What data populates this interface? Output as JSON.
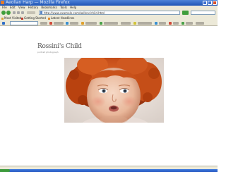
{
  "window": {
    "title": "Aeolian Harp — Mozilla Firefox"
  },
  "menubar": {
    "items": [
      "File",
      "Edit",
      "View",
      "History",
      "Bookmarks",
      "Tools",
      "Help"
    ]
  },
  "navbar": {
    "address": "http://www.example.com/gallery/child.html"
  },
  "bookmarks": {
    "items": [
      "Most Visited",
      "Getting Started",
      "Latest Headlines"
    ]
  },
  "content": {
    "heading": "Rossini's Child",
    "subtitle": "portrait photograph"
  },
  "colors": {
    "accent": "#1f54b6",
    "chrome": "#ece9d8"
  }
}
